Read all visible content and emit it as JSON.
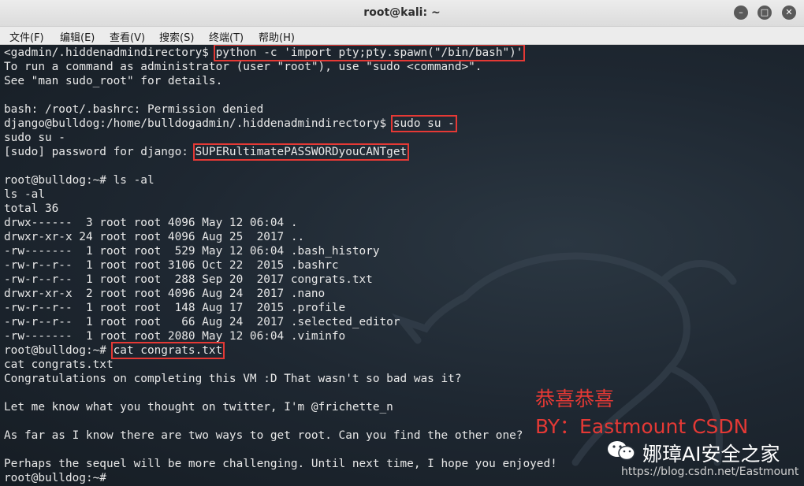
{
  "window": {
    "title": "root@kali: ~",
    "minimize_glyph": "–",
    "maximize_glyph": "□",
    "close_glyph": "✕"
  },
  "menu": [
    "文件(F)",
    "编辑(E)",
    "查看(V)",
    "搜索(S)",
    "终端(T)",
    "帮助(H)"
  ],
  "terminal": {
    "lines": [
      {
        "segments": [
          {
            "t": "<gadmin/.hiddenadmindirectory$ "
          },
          {
            "t": "python -c 'import pty;pty.spawn(\"/bin/bash\")'",
            "hl": true
          }
        ]
      },
      {
        "segments": [
          {
            "t": "To run a command as administrator (user \"root\"), use \"sudo <command>\"."
          }
        ]
      },
      {
        "segments": [
          {
            "t": "See \"man sudo_root\" for details."
          }
        ]
      },
      {
        "segments": [
          {
            "t": ""
          }
        ]
      },
      {
        "segments": [
          {
            "t": "bash: /root/.bashrc: Permission denied"
          }
        ]
      },
      {
        "segments": [
          {
            "t": "django@bulldog:/home/bulldogadmin/.hiddenadmindirectory$ "
          },
          {
            "t": "sudo su -",
            "hl": true
          }
        ]
      },
      {
        "segments": [
          {
            "t": "sudo su -"
          }
        ]
      },
      {
        "segments": [
          {
            "t": "[sudo] password for django: "
          },
          {
            "t": "SUPERultimatePASSWORDyouCANTget",
            "hl": true
          }
        ]
      },
      {
        "segments": [
          {
            "t": ""
          }
        ]
      },
      {
        "segments": [
          {
            "t": "root@bulldog:~# ls -al"
          }
        ]
      },
      {
        "segments": [
          {
            "t": "ls -al"
          }
        ]
      },
      {
        "segments": [
          {
            "t": "total 36"
          }
        ]
      },
      {
        "segments": [
          {
            "t": "drwx------  3 root root 4096 May 12 06:04 ."
          }
        ]
      },
      {
        "segments": [
          {
            "t": "drwxr-xr-x 24 root root 4096 Aug 25  2017 .."
          }
        ]
      },
      {
        "segments": [
          {
            "t": "-rw-------  1 root root  529 May 12 06:04 .bash_history"
          }
        ]
      },
      {
        "segments": [
          {
            "t": "-rw-r--r--  1 root root 3106 Oct 22  2015 .bashrc"
          }
        ]
      },
      {
        "segments": [
          {
            "t": "-rw-r--r--  1 root root  288 Sep 20  2017 congrats.txt"
          }
        ]
      },
      {
        "segments": [
          {
            "t": "drwxr-xr-x  2 root root 4096 Aug 24  2017 .nano"
          }
        ]
      },
      {
        "segments": [
          {
            "t": "-rw-r--r--  1 root root  148 Aug 17  2015 .profile"
          }
        ]
      },
      {
        "segments": [
          {
            "t": "-rw-r--r--  1 root root   66 Aug 24  2017 .selected_editor"
          }
        ]
      },
      {
        "segments": [
          {
            "t": "-rw-------  1 root root 2080 May 12 06:04 .viminfo"
          }
        ]
      },
      {
        "segments": [
          {
            "t": "root@bulldog:~# "
          },
          {
            "t": "cat congrats.txt",
            "hl": true
          }
        ]
      },
      {
        "segments": [
          {
            "t": "cat congrats.txt"
          }
        ]
      },
      {
        "segments": [
          {
            "t": "Congratulations on completing this VM :D That wasn't so bad was it?"
          }
        ]
      },
      {
        "segments": [
          {
            "t": ""
          }
        ]
      },
      {
        "segments": [
          {
            "t": "Let me know what you thought on twitter, I'm @frichette_n"
          }
        ]
      },
      {
        "segments": [
          {
            "t": ""
          }
        ]
      },
      {
        "segments": [
          {
            "t": "As far as I know there are two ways to get root. Can you find the other one?"
          }
        ]
      },
      {
        "segments": [
          {
            "t": ""
          }
        ]
      },
      {
        "segments": [
          {
            "t": "Perhaps the sequel will be more challenging. Until next time, I hope you enjoyed!"
          }
        ]
      },
      {
        "segments": [
          {
            "t": "root@bulldog:~# "
          }
        ]
      }
    ]
  },
  "overlay": {
    "congrats_cn": "恭喜恭喜",
    "by_line": "BY：Eastmount CSDN"
  },
  "watermark": {
    "name": "娜璋AI安全之家",
    "url": "https://blog.csdn.net/Eastmount"
  },
  "colors": {
    "highlight_box": "#e53935",
    "terminal_text": "#e8e8e8",
    "terminal_bg": "#1e2731"
  }
}
